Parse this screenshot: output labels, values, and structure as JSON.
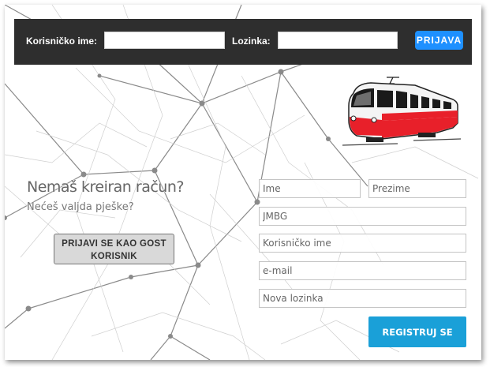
{
  "header": {
    "username_label": "Korisničko ime:",
    "username_value": "",
    "password_label": "Lozinka:",
    "password_value": "",
    "login_button": "PRIJAVA"
  },
  "promo": {
    "title": "Nemaš kreiran račun?",
    "subtitle": "Nećeš valjda pješke?",
    "guest_button": "PRIJAVI SE KAO GOST KORISNIK"
  },
  "register": {
    "first_name_placeholder": "Ime",
    "last_name_placeholder": "Prezime",
    "jmbg_placeholder": "JMBG",
    "username_placeholder": "Korisničko ime",
    "email_placeholder": "e-mail",
    "password_placeholder": "Nova lozinka",
    "submit_button": "REGISTRUJ SE"
  },
  "icons": {
    "logo": "tram-icon",
    "background": "network-lines-pattern"
  },
  "colors": {
    "topbar": "#2e2e2e",
    "login_button": "#1e90ff",
    "register_button": "#1aa0d8",
    "guest_button": "#d9d9d9",
    "tram_red": "#e8202a"
  }
}
